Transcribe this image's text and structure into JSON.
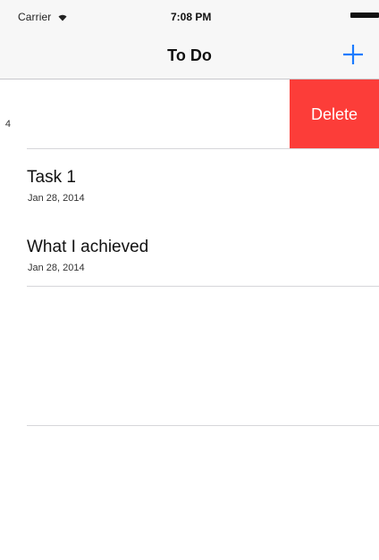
{
  "status_bar": {
    "carrier": "Carrier",
    "time": "7:08 PM"
  },
  "nav_bar": {
    "title": "To Do",
    "add_icon": "plus-icon",
    "accent_color": "#1a7bff"
  },
  "rows": [
    {
      "title": "",
      "date": "4",
      "state": "swiped",
      "delete_label": "Delete",
      "delete_color": "#fc3d39"
    },
    {
      "title": "Task 1",
      "date": "Jan 28, 2014"
    },
    {
      "title": "What I achieved",
      "date": "Jan 28, 2014"
    }
  ]
}
